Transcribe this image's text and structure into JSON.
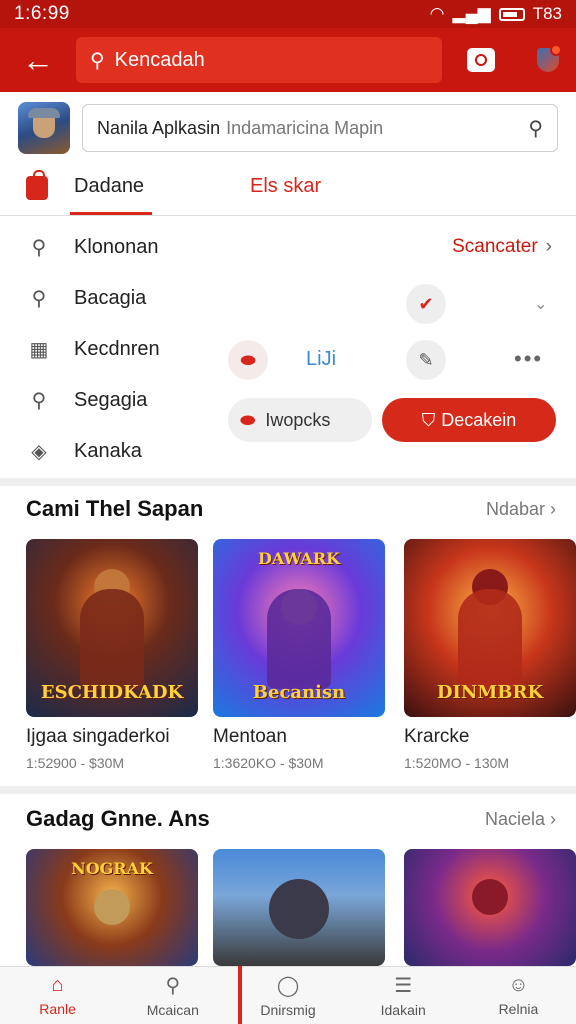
{
  "status_bar": {
    "time": "1:6:99",
    "right_text": "T83"
  },
  "app_bar": {
    "search_text": "Kencadah"
  },
  "app_row": {
    "search_label": "Nanila Aplkasin",
    "search_placeholder": "Indamaricina Mapin"
  },
  "tabs": [
    {
      "label": "Dadane",
      "active": true
    },
    {
      "label": "Els skar",
      "active": false
    }
  ],
  "menu": {
    "items": [
      {
        "icon": "search-icon",
        "label": "Klononan"
      },
      {
        "icon": "search-icon",
        "label": "Bacagia"
      },
      {
        "icon": "calendar-icon",
        "label": "Kecdnren"
      },
      {
        "icon": "search-icon",
        "label": "Segagia"
      },
      {
        "icon": "mask-icon",
        "label": "Kanaka"
      }
    ]
  },
  "side_link": "Scancater",
  "small_label": "LiJi",
  "buttons": {
    "secondary": "Iwopcks",
    "primary": "Decakein"
  },
  "section1": {
    "title": "Cami Thel Sapan",
    "more": "Ndabar",
    "games": [
      {
        "name": "Ijgaa singaderkoi",
        "meta": "1:52900 - $30M",
        "banner": "ESCHIDKADK",
        "top": ""
      },
      {
        "name": "Mentoan",
        "meta": "1:3620KO - $30M",
        "banner": "Becanisn",
        "top": "DAWARK"
      },
      {
        "name": "Krarcke",
        "meta": "1:520MO - 130M",
        "banner": "DINMBRK",
        "top": ""
      }
    ]
  },
  "section2": {
    "title": "Gadag Gnne. Ans",
    "more": "Naciela",
    "games": [
      {
        "banner": "",
        "top": "NOGRAK"
      },
      {
        "banner": "",
        "top": ""
      },
      {
        "banner": "",
        "top": ""
      }
    ]
  },
  "bottom_nav": [
    {
      "icon": "home-icon",
      "label": "Ranle",
      "active": true
    },
    {
      "icon": "search-icon",
      "label": "Mcaican",
      "active": false
    },
    {
      "icon": "chat-icon",
      "label": "Dnirsmig",
      "active": false
    },
    {
      "icon": "list-icon",
      "label": "Idakain",
      "active": false
    },
    {
      "icon": "person-icon",
      "label": "Relnia",
      "active": false
    }
  ],
  "colors": {
    "brand_red": "#c8170e",
    "accent_red": "#d7261b"
  }
}
